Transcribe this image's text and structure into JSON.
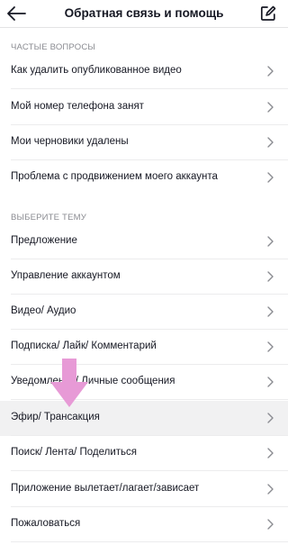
{
  "header": {
    "title": "Обратная связь и помощь"
  },
  "sections": [
    {
      "header": "ЧАСТЫЕ ВОПРОСЫ",
      "items": [
        "Как удалить опубликованное видео",
        "Мой номер телефона занят",
        "Мои черновики удалены",
        "Проблема с продвижением моего аккаунта"
      ]
    },
    {
      "header": "ВЫБЕРИТЕ ТЕМУ",
      "items": [
        "Предложение",
        "Управление аккаунтом",
        "Видео/ Аудио",
        "Подписка/ Лайк/ Комментарий",
        "Уведомления/ Личные сообщения",
        "Эфир/ Трансакция",
        "Поиск/ Лента/ Поделиться",
        "Приложение вылетает/лагает/зависает",
        "Пожаловаться"
      ]
    }
  ],
  "highlighted_item": "Эфир/ Трансакция",
  "icons": {
    "back": "back-arrow-icon",
    "edit": "edit-note-icon",
    "chevron": "chevron-right-icon",
    "pointer": "down-arrow-pointer-icon"
  },
  "colors": {
    "highlight_row": "#f1f1f2",
    "pointer_arrow": "#e79ad6",
    "section_header_text": "#8a8b91"
  }
}
